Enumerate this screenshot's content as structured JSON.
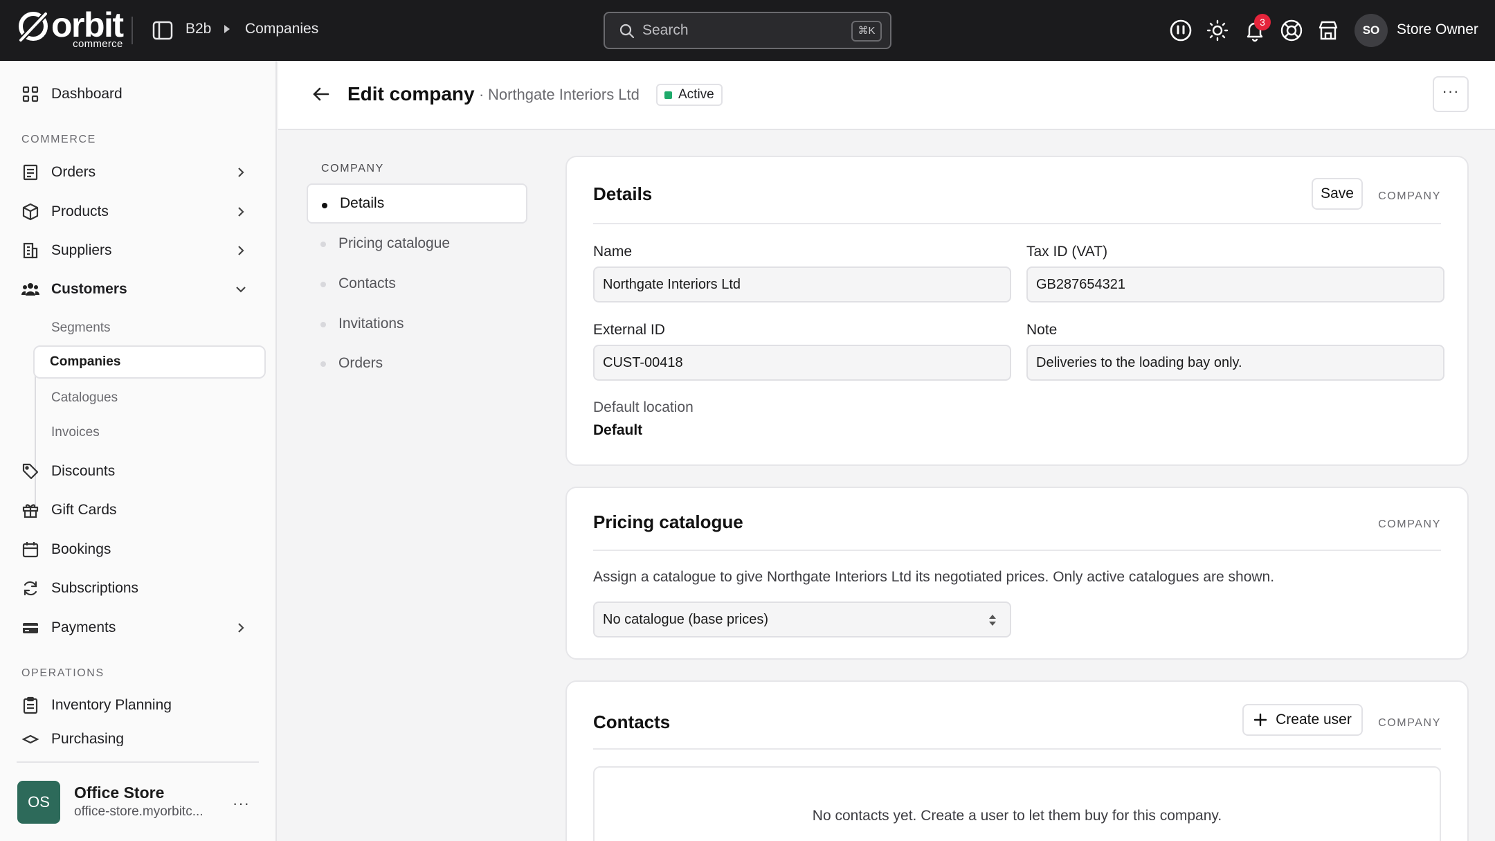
{
  "topbar": {
    "logo_word": "orbit",
    "logo_sub": "commerce",
    "breadcrumb": [
      "B2b",
      "Companies"
    ],
    "search_placeholder": "Search",
    "search_shortcut": "⌘K",
    "notifications_count": "3",
    "avatar_initials": "SO",
    "user_name": "Store Owner"
  },
  "sidebar": {
    "dashboard": "Dashboard",
    "commerce_label": "COMMERCE",
    "orders": "Orders",
    "products": "Products",
    "suppliers": "Suppliers",
    "customers": "Customers",
    "customer_sub": [
      "Segments",
      "Companies",
      "Catalogues",
      "Invoices"
    ],
    "discounts": "Discounts",
    "gift_cards": "Gift Cards",
    "bookings": "Bookings",
    "subscriptions": "Subscriptions",
    "payments": "Payments",
    "operations_label": "OPERATIONS",
    "inventory_planning": "Inventory Planning",
    "purchasing": "Purchasing",
    "store": {
      "initials": "OS",
      "name": "Office Store",
      "url": "office-store.myorbitc..."
    }
  },
  "header": {
    "title": "Edit company",
    "separator": "·",
    "company_name": "Northgate Interiors Ltd",
    "status": "Active",
    "more": "···"
  },
  "section_nav": {
    "label": "COMPANY",
    "items": [
      "Details",
      "Pricing catalogue",
      "Contacts",
      "Invitations",
      "Orders"
    ]
  },
  "details": {
    "title": "Details",
    "save_label": "Save",
    "tag": "COMPANY",
    "name_label": "Name",
    "name_value": "Northgate Interiors Ltd",
    "tax_label": "Tax ID (VAT)",
    "tax_value": "GB287654321",
    "external_label": "External ID",
    "external_value": "CUST-00418",
    "note_label": "Note",
    "note_value": "Deliveries to the loading bay only.",
    "location_label": "Default location",
    "location_value": "Default"
  },
  "pricing": {
    "title": "Pricing catalogue",
    "tag": "COMPANY",
    "description": "Assign a catalogue to give Northgate Interiors Ltd its negotiated prices. Only active catalogues are shown.",
    "selected": "No catalogue (base prices)"
  },
  "contacts": {
    "title": "Contacts",
    "create_label": "Create user",
    "tag": "COMPANY",
    "empty_text": "No contacts yet. Create a user to let them buy for this company."
  },
  "colors": {
    "topbar_bg": "#1b1b1d",
    "status_active": "#1faa6b",
    "badge": "#e5243b",
    "store_logo": "#2d6a5a"
  }
}
